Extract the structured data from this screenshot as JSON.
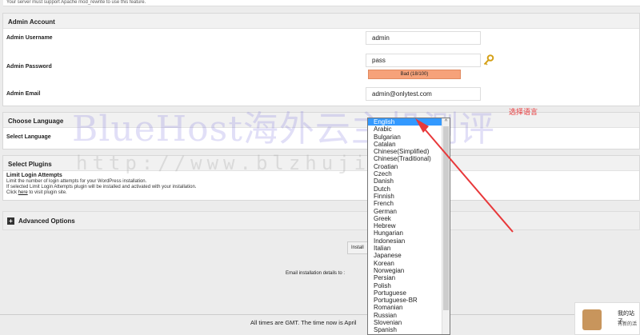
{
  "top_note": "Your server must support Apache mod_rewrite to use this feature.",
  "admin_account": {
    "heading": "Admin Account",
    "username_label": "Admin Username",
    "username_value": "admin",
    "password_label": "Admin Password",
    "password_value": "pass",
    "strength_text": "Bad (18/100)",
    "email_label": "Admin Email",
    "email_value": "admin@onlytest.com"
  },
  "language": {
    "heading": "Choose Language",
    "select_label": "Select Language",
    "selected": "English",
    "options": [
      "English",
      "Arabic",
      "Bulgarian",
      "Catalan",
      "Chinese(Simplified)",
      "Chinese(Traditional)",
      "Croatian",
      "Czech",
      "Danish",
      "Dutch",
      "Finnish",
      "French",
      "German",
      "Greek",
      "Hebrew",
      "Hungarian",
      "Indonesian",
      "Italian",
      "Japanese",
      "Korean",
      "Norwegian",
      "Persian",
      "Polish",
      "Portuguese",
      "Portuguese-BR",
      "Romanian",
      "Russian",
      "Slovenian",
      "Spanish"
    ]
  },
  "plugins": {
    "heading": "Select Plugins",
    "plugin_name": "Limit Login Attempts",
    "desc1": "Limit the number of login attempts for your WordPress installation.",
    "desc2": "If selected Limit Login Attempts plugin will be installed and activated with your installation.",
    "desc3_pre": "Click ",
    "desc3_link": "here",
    "desc3_post": " to visit plugin site."
  },
  "advanced": {
    "label": "Advanced Options",
    "toggle": "+"
  },
  "install_button": "Install",
  "email_details_label": "Email installation details to :",
  "footer_text": "All times are GMT. The time now is April",
  "annotation": "选择语言",
  "watermark": {
    "main": "BlueHost海外云主机测评",
    "url": "http://www.blzhuji.com/"
  },
  "chat_widget": {
    "line1": "我的站子",
    "line2": "有新的活"
  },
  "colors": {
    "accent": "#3399ff",
    "strength_bad": "#f6a27a",
    "annotation": "#e8383a"
  }
}
